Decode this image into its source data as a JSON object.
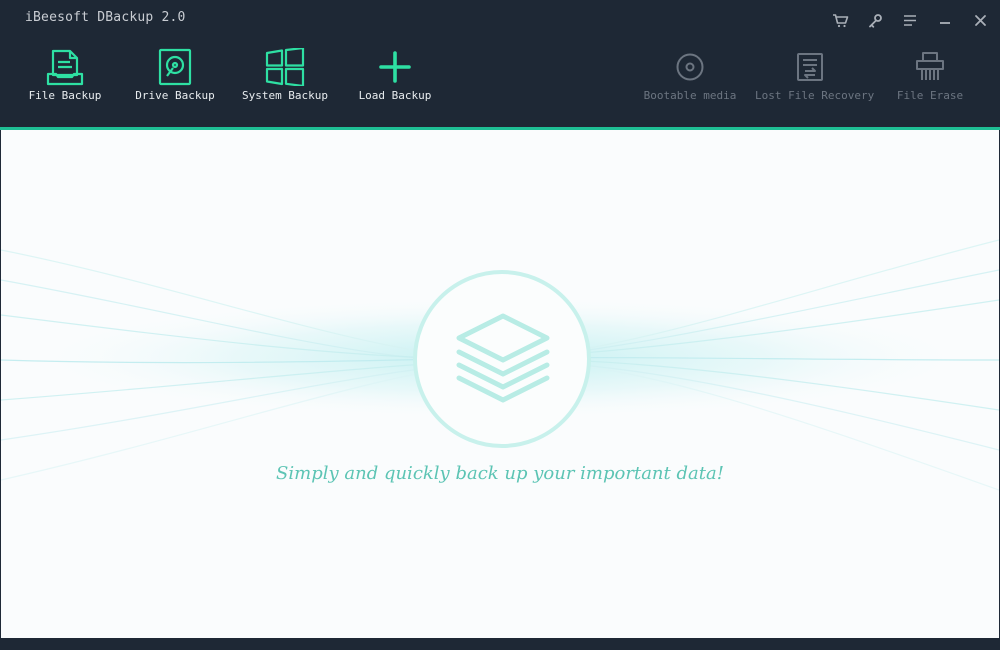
{
  "app": {
    "title": "iBeesoft DBackup 2.0"
  },
  "window_controls": [
    {
      "name": "cart-icon"
    },
    {
      "name": "key-icon"
    },
    {
      "name": "menu-icon"
    },
    {
      "name": "minimize-icon"
    },
    {
      "name": "close-icon"
    }
  ],
  "toolbar": {
    "primary": [
      {
        "id": "file-backup",
        "label": "File Backup",
        "icon": "file-backup-icon"
      },
      {
        "id": "drive-backup",
        "label": "Drive Backup",
        "icon": "drive-backup-icon"
      },
      {
        "id": "system-backup",
        "label": "System Backup",
        "icon": "system-backup-icon"
      },
      {
        "id": "load-backup",
        "label": "Load Backup",
        "icon": "plus-icon"
      }
    ],
    "secondary": [
      {
        "id": "bootable-media",
        "label": "Bootable media",
        "icon": "disc-icon"
      },
      {
        "id": "lost-file-recovery",
        "label": "Lost File Recovery",
        "icon": "file-recovery-icon"
      },
      {
        "id": "file-erase",
        "label": "File Erase",
        "icon": "shredder-icon"
      }
    ]
  },
  "main": {
    "tagline": "Simply and quickly back up your important data!",
    "hero_icon": "stacked-layers-icon"
  },
  "colors": {
    "accent": "#1fbf95",
    "header_bg": "#1e2835",
    "tagline": "#5cc4b4",
    "disabled_label": "#6c7581"
  }
}
